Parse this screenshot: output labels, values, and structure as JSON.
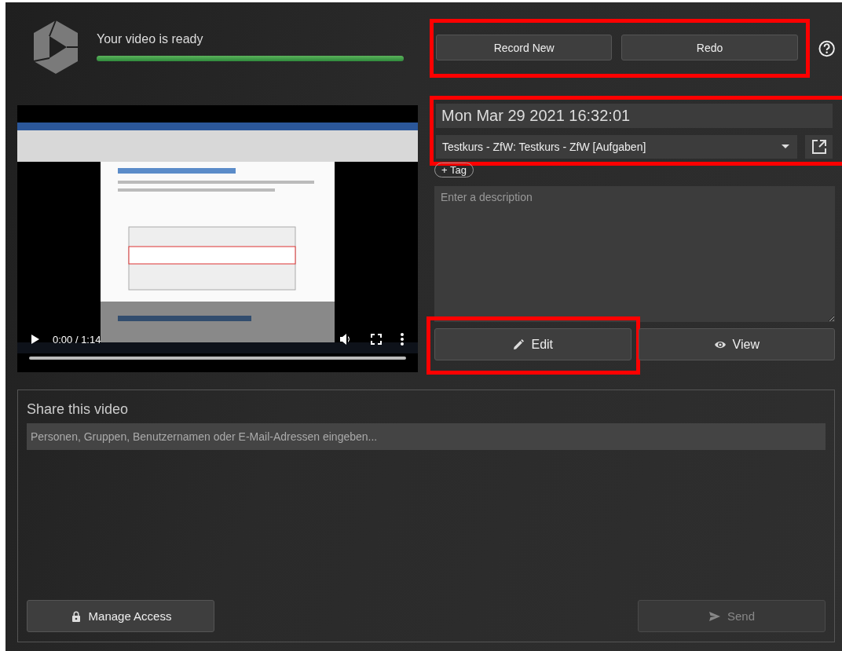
{
  "status": {
    "title": "Your video is ready",
    "level": 1
  },
  "header_buttons": {
    "highlighted": true,
    "buttons": [
      {
        "label": "Record New"
      },
      {
        "label": "Redo"
      }
    ]
  },
  "video": {
    "kind": "picture",
    "time": "0:00 / 1:14"
  },
  "details": {
    "highlighted": true,
    "title": "Mon Mar 29 2021 16:32:01",
    "folder": "Testkurs - ZfW: Testkurs - ZfW [Aufgaben]"
  },
  "tag_button": "+ Tag",
  "description": {
    "placeholder": "Enter a description"
  },
  "actions": [
    {
      "label": "Edit",
      "kind": "pencil",
      "highlighted": true
    },
    {
      "label": "View",
      "kind": "eye",
      "highlighted": false
    }
  ],
  "share": {
    "title": "Share this video",
    "placeholder": "Personen, Gruppen, Benutzernamen oder E-Mail-Adressen eingeben...",
    "buttons": [
      {
        "label": "Manage Access",
        "kind": "lock",
        "disabled": false
      },
      {
        "label": "Send",
        "kind": "send",
        "disabled": true
      }
    ]
  }
}
